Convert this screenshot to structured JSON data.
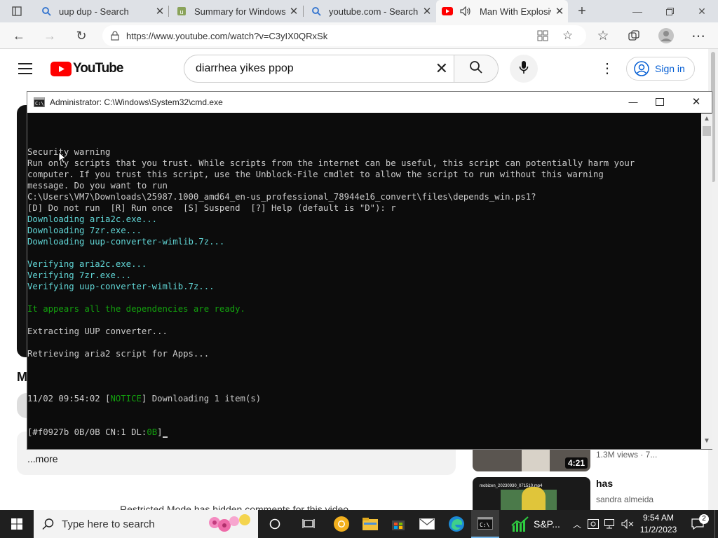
{
  "browser": {
    "tabs": [
      {
        "label": "uup dup - Search"
      },
      {
        "label": "Summary for Windows"
      },
      {
        "label": "youtube.com - Search"
      },
      {
        "label": "Man With Explosiv"
      }
    ],
    "url": "https://www.youtube.com/watch?v=C3yIX0QRxSk"
  },
  "youtube": {
    "logo_text": "YouTube",
    "search_value": "diarrhea yikes ppop",
    "sign_in": "Sign in",
    "more": "...more",
    "restricted": "Restricted Mode has hidden comments for this video.",
    "sidebar": [
      {
        "duration": "4:21",
        "meta": "1.3M views · 7..."
      },
      {
        "title": "has",
        "channel": "sandra almeida",
        "thumb_text": "mobizen_20230930_071510.mp4"
      }
    ],
    "m_letter": "M"
  },
  "cmd": {
    "title": "Administrator: C:\\Windows\\System32\\cmd.exe",
    "lines": [
      {
        "text": "Security warning",
        "cls": ""
      },
      {
        "text": "Run only scripts that you trust. While scripts from the internet can be useful, this script can potentially harm your",
        "cls": ""
      },
      {
        "text": "computer. If you trust this script, use the Unblock-File cmdlet to allow the script to run without this warning",
        "cls": ""
      },
      {
        "text": "message. Do you want to run",
        "cls": ""
      },
      {
        "text": "C:\\Users\\VM7\\Downloads\\25987.1000_amd64_en-us_professional_78944e16_convert\\files\\depends_win.ps1?",
        "cls": ""
      },
      {
        "text": "[D] Do not run  [R] Run once  [S] Suspend  [?] Help (default is \"D\"): r",
        "cls": ""
      },
      {
        "text": "Downloading aria2c.exe...",
        "cls": "t"
      },
      {
        "text": "Downloading 7zr.exe...",
        "cls": "t"
      },
      {
        "text": "Downloading uup-converter-wimlib.7z...",
        "cls": "t"
      },
      {
        "text": "",
        "cls": ""
      },
      {
        "text": "Verifying aria2c.exe...",
        "cls": "t"
      },
      {
        "text": "Verifying 7zr.exe...",
        "cls": "t"
      },
      {
        "text": "Verifying uup-converter-wimlib.7z...",
        "cls": "t"
      },
      {
        "text": "",
        "cls": ""
      },
      {
        "text": "It appears all the dependencies are ready.",
        "cls": "g"
      },
      {
        "text": "",
        "cls": ""
      },
      {
        "text": "Extracting UUP converter...",
        "cls": ""
      },
      {
        "text": "",
        "cls": ""
      },
      {
        "text": "Retrieving aria2 script for Apps...",
        "cls": ""
      },
      {
        "text": "",
        "cls": ""
      }
    ],
    "notice": {
      "time": "11/02 09:54:02",
      "tag": "NOTICE",
      "msg": "Downloading 1 item(s)"
    },
    "progress": {
      "id": "#f0927b",
      "size": "0B/0B",
      "cn": "CN:1",
      "dl_label": "DL:",
      "dl": "0B"
    }
  },
  "taskbar": {
    "search_placeholder": "Type here to search",
    "sp_label": "S&P...",
    "time": "9:54 AM",
    "date": "11/2/2023",
    "notif_count": "2"
  }
}
